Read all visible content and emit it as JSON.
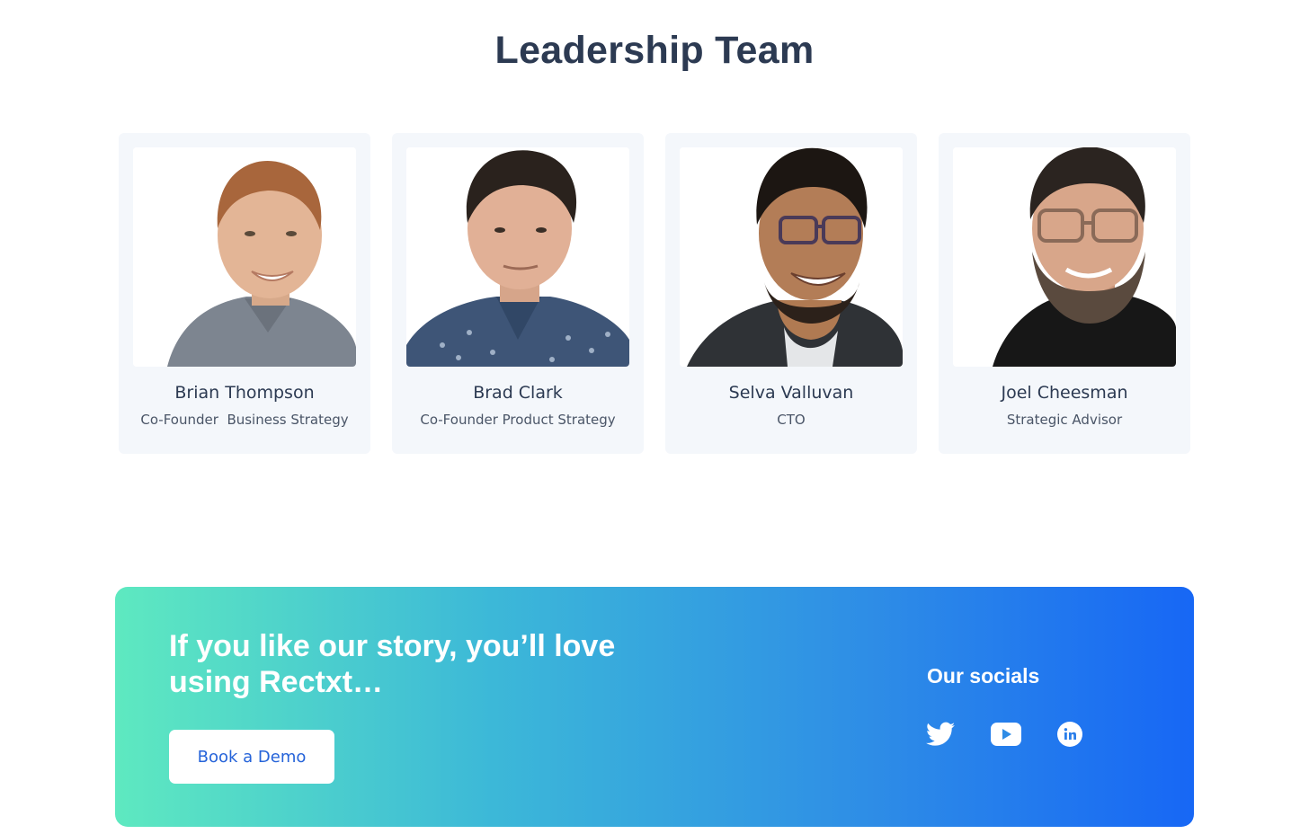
{
  "section": {
    "title": "Leadership Team"
  },
  "team": [
    {
      "name": "Brian Thompson",
      "role": "Co-Founder  Business Strategy",
      "photo": "brian-thompson-photo"
    },
    {
      "name": "Brad Clark",
      "role": "Co-Founder Product Strategy",
      "photo": "brad-clark-photo"
    },
    {
      "name": "Selva Valluvan",
      "role": "CTO",
      "photo": "selva-valluvan-photo"
    },
    {
      "name": "Joel Cheesman",
      "role": "Strategic Advisor",
      "photo": "joel-cheesman-photo"
    }
  ],
  "cta": {
    "heading": "If you like our story, you’ll love using Rectxt…",
    "button_label": "Book a Demo",
    "socials_title": "Our socials",
    "socials": [
      "twitter-icon",
      "youtube-icon",
      "linkedin-icon"
    ]
  },
  "colors": {
    "heading": "#2c3a52",
    "card_background": "#f4f7fb",
    "gradient_start": "#5ee9c0",
    "gradient_end": "#1767f5",
    "button_text": "#2563d9"
  }
}
